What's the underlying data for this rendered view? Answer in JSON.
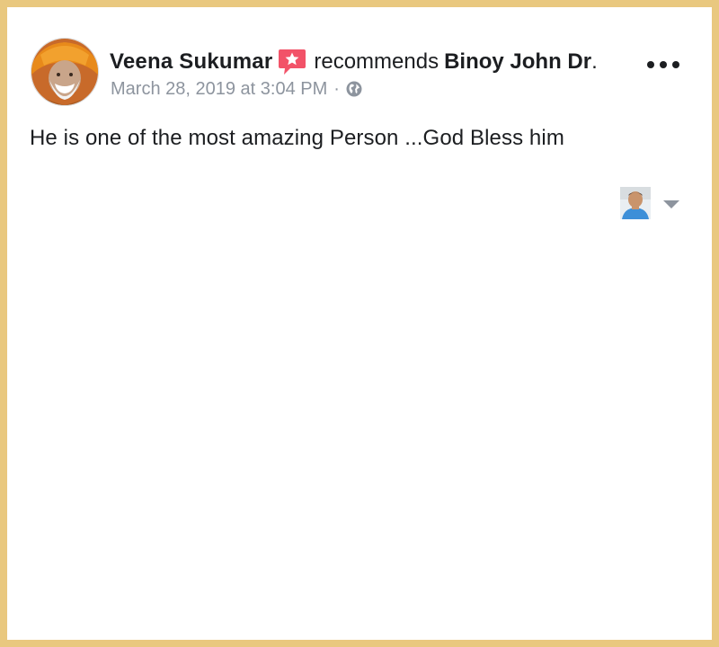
{
  "post": {
    "author": "Veena Sukumar",
    "action": "recommends",
    "target": "Binoy John Dr",
    "target_suffix": ".",
    "timestamp": "March 28, 2019 at 3:04 PM",
    "separator": "·",
    "privacy_icon": "globe-icon",
    "recommendation_icon": "recommendation-star-icon",
    "more_icon": "more-options-icon",
    "text": "He is one of the most amazing Person ...God Bless him"
  },
  "colors": {
    "frame": "#e9c87f",
    "text": "#1c1e21",
    "meta": "#8d949e",
    "recommend_badge": "#f25268"
  }
}
